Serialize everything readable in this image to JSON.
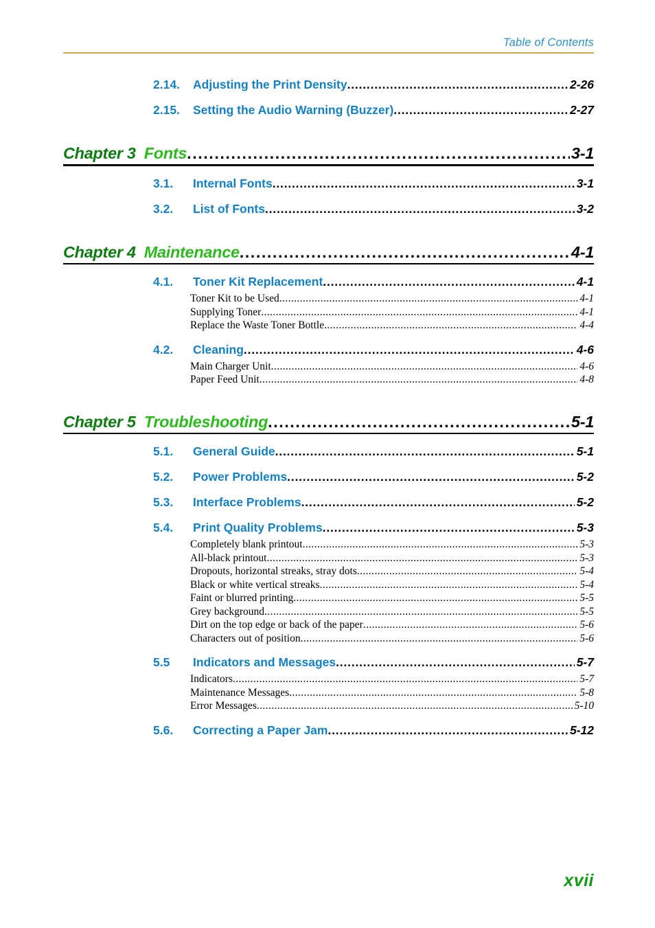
{
  "header": {
    "title": "Table of Contents",
    "rule_color": "#c9a83c",
    "title_color": "#2e8fc4"
  },
  "colors": {
    "chapter_label": "#0e7a12",
    "chapter_title": "#2fb820",
    "section": "#1580c0",
    "sub": "#000000",
    "footer": "#119911"
  },
  "leader_dots": "..........................................................................................................................................................................................................",
  "entries": {
    "orphan_sections": [
      {
        "num": "2.14.",
        "title": "Adjusting the Print Density",
        "page": "2-26"
      },
      {
        "num": "2.15.",
        "title": "Setting the Audio Warning (Buzzer)",
        "page": "2-27"
      }
    ],
    "chapters": [
      {
        "label": "Chapter 3",
        "title": "Fonts",
        "page": "3-1",
        "sections": [
          {
            "num": "3.1.",
            "title": "Internal Fonts",
            "page": "3-1",
            "subs": []
          },
          {
            "num": "3.2.",
            "title": "List of Fonts",
            "page": "3-2",
            "subs": []
          }
        ]
      },
      {
        "label": "Chapter 4",
        "title": "Maintenance",
        "page": "4-1",
        "sections": [
          {
            "num": "4.1.",
            "title": "Toner Kit Replacement",
            "page": "4-1",
            "subs": [
              {
                "title": "Toner Kit to be Used",
                "page": "4-1"
              },
              {
                "title": "Supplying Toner",
                "page": "4-1"
              },
              {
                "title": "Replace the Waste Toner Bottle",
                "page": "4-4"
              }
            ]
          },
          {
            "num": "4.2.",
            "title": "Cleaning",
            "page": "4-6",
            "subs": [
              {
                "title": "Main Charger Unit",
                "page": "4-6"
              },
              {
                "title": "Paper Feed Unit",
                "page": "4-8"
              }
            ]
          }
        ]
      },
      {
        "label": "Chapter 5",
        "title": "Troubleshooting",
        "page": "5-1",
        "sections": [
          {
            "num": "5.1.",
            "title": "General Guide",
            "page": "5-1",
            "subs": []
          },
          {
            "num": "5.2.",
            "title": "Power Problems",
            "page": "5-2",
            "subs": []
          },
          {
            "num": "5.3.",
            "title": "Interface Problems",
            "page": "5-2",
            "subs": []
          },
          {
            "num": "5.4.",
            "title": "Print Quality Problems",
            "page": "5-3",
            "subs": [
              {
                "title": "Completely blank printout",
                "page": "5-3"
              },
              {
                "title": "All-black printout",
                "page": "5-3"
              },
              {
                "title": "Dropouts, horizontal streaks, stray dots",
                "page": "5-4"
              },
              {
                "title": "Black or white vertical streaks",
                "page": "5-4"
              },
              {
                "title": "Faint or blurred printing",
                "page": "5-5"
              },
              {
                "title": "Grey background",
                "page": "5-5"
              },
              {
                "title": "Dirt on the top edge or back of the paper",
                "page": "5-6"
              },
              {
                "title": "Characters out of position",
                "page": "5-6"
              }
            ]
          },
          {
            "num": "5.5",
            "title": "Indicators and Messages",
            "page": "5-7",
            "subs": [
              {
                "title": "Indicators",
                "page": "5-7"
              },
              {
                "title": "Maintenance Messages",
                "page": "5-8"
              },
              {
                "title": "Error Messages",
                "page": "5-10"
              }
            ]
          },
          {
            "num": "5.6.",
            "title": "Correcting a Paper Jam",
            "page": "5-12",
            "subs": []
          }
        ]
      }
    ]
  },
  "footer": {
    "page_number": "xvii"
  }
}
